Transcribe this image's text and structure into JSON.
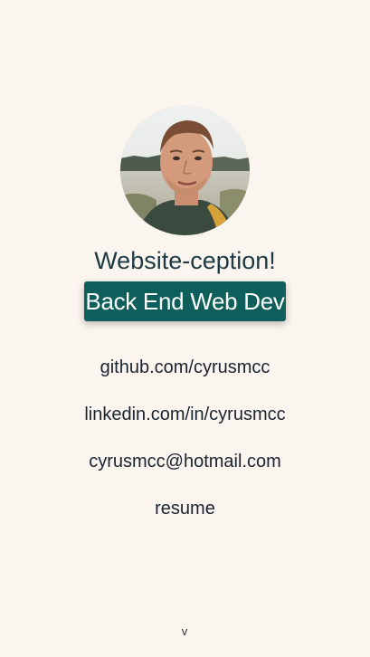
{
  "profile": {
    "avatar_alt": "profile photo"
  },
  "header": {
    "subtitle": "Website-ception!",
    "role": "Back End Web Dev"
  },
  "links": [
    {
      "label": "github.com/cyrusmcc"
    },
    {
      "label": "linkedin.com/in/cyrusmcc"
    },
    {
      "label": "cyrusmcc@hotmail.com"
    },
    {
      "label": "resume"
    }
  ],
  "scroll": {
    "glyph": "v",
    "icon": "chevron-down-icon"
  },
  "colors": {
    "background": "#faf5ee",
    "accent": "#0e5e5b",
    "subtitle_text": "#1e3a44",
    "body_text": "#1b2330"
  }
}
